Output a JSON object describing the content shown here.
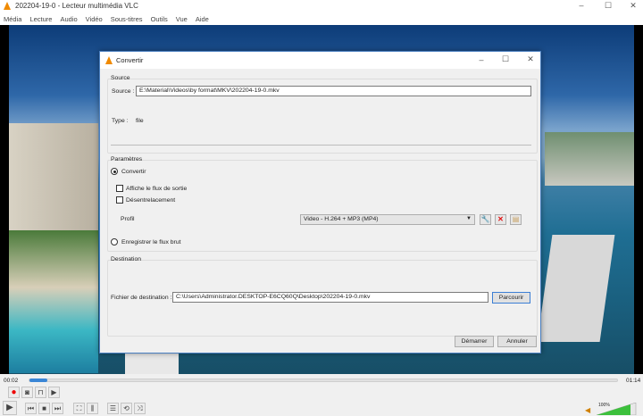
{
  "window": {
    "title": "202204-19-0 - Lecteur multimédia VLC"
  },
  "menu": [
    "Média",
    "Lecture",
    "Audio",
    "Vidéo",
    "Sous-titres",
    "Outils",
    "Vue",
    "Aide"
  ],
  "dialog": {
    "title": "Convertir",
    "source_group": "Source",
    "source_label": "Source :",
    "source_value": "E:\\Material\\Videos\\by format\\MKV\\202204-19-0.mkv",
    "type_label": "Type :",
    "type_value": "file",
    "params_group": "Paramètres",
    "convert_radio": "Convertir",
    "show_output": "Affiche le flux de sortie",
    "deinterlace": "Désentrelacement",
    "profile_label": "Profil",
    "profile_value": "Video - H.264 + MP3 (MP4)",
    "raw_radio": "Enregistrer le flux brut",
    "dest_group": "Destination",
    "dest_label": "Fichier de destination :",
    "dest_value": "C:\\Users\\Administrator.DESKTOP-E6CQ60Q\\Desktop\\202204-19-0.mkv",
    "browse": "Parcourir",
    "start": "Démarrer",
    "cancel": "Annuler"
  },
  "player": {
    "elapsed": "00:02",
    "total": "01:14",
    "progress": 0.027,
    "volume": "100%",
    "volume_level": 1.0
  }
}
